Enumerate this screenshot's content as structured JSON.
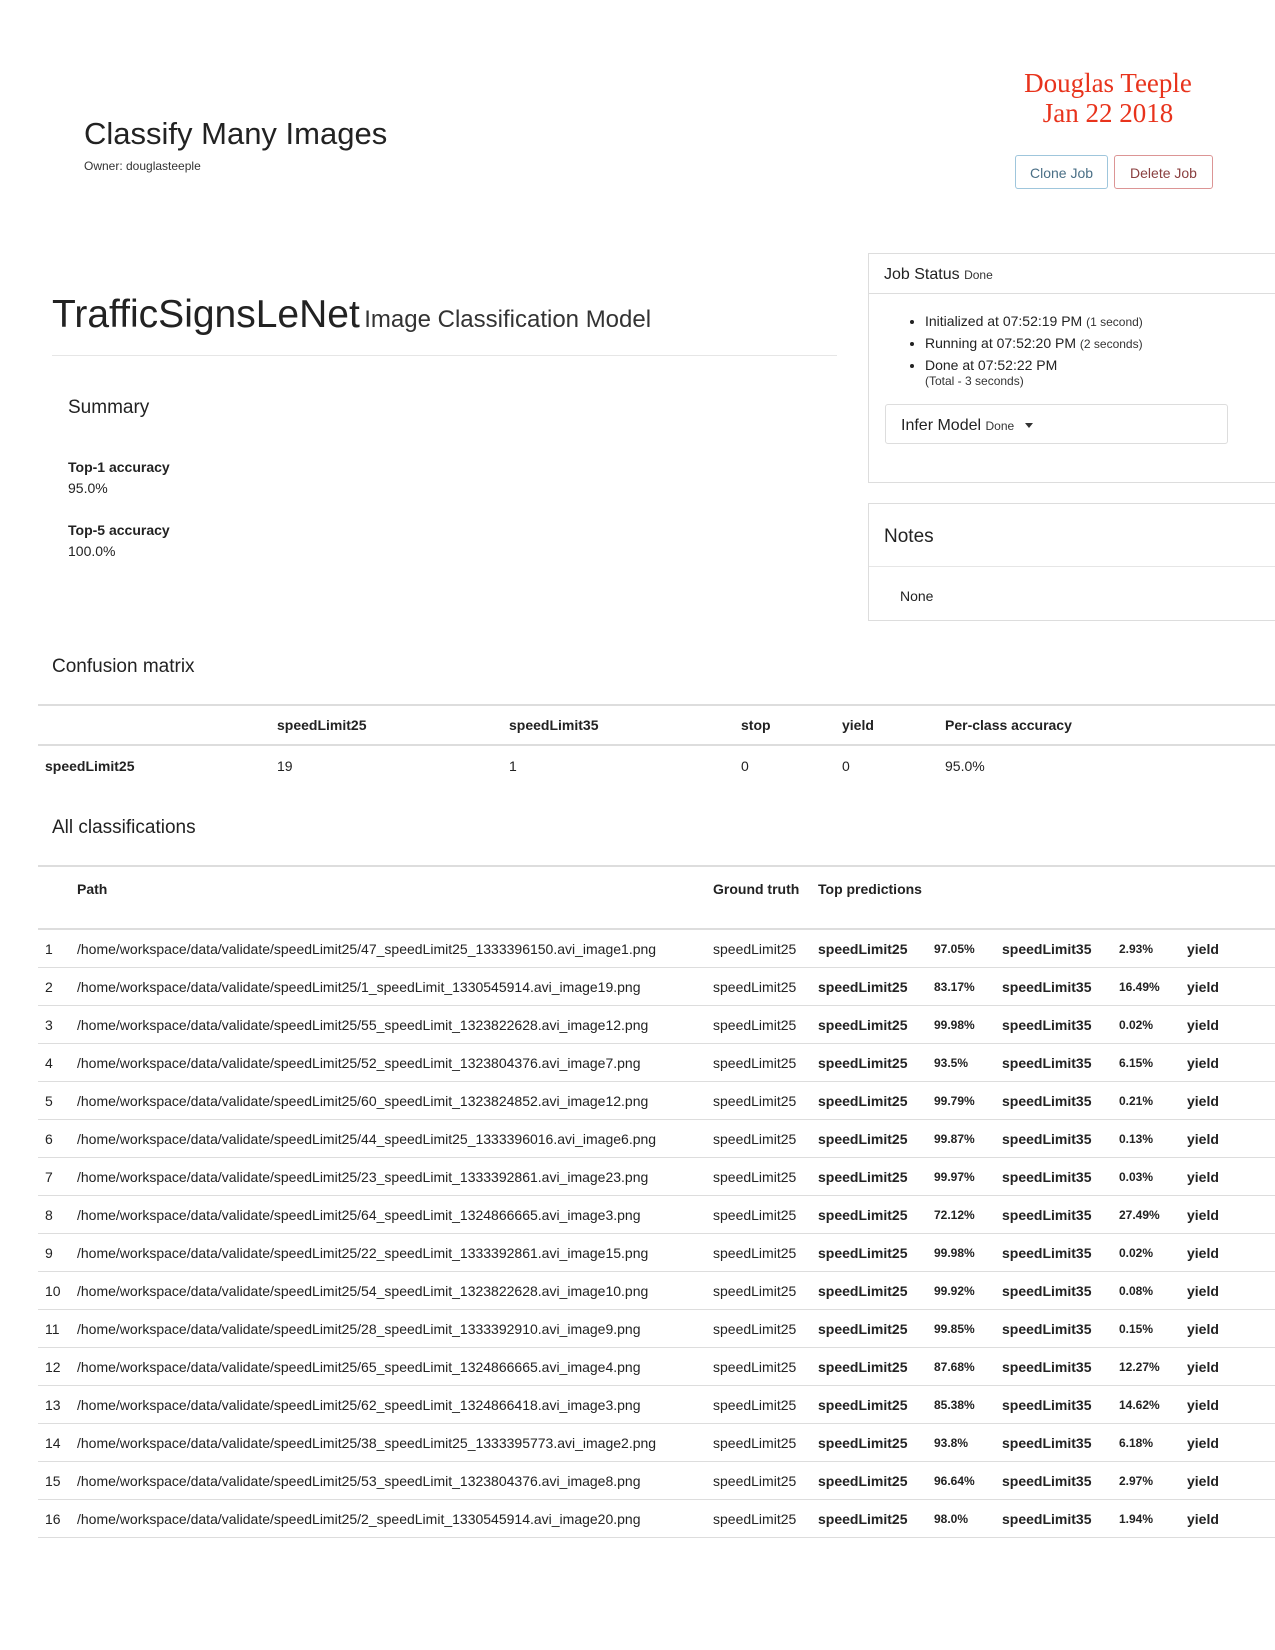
{
  "annotation": {
    "name": "Douglas Teeple",
    "date": "Jan 22 2018"
  },
  "header": {
    "title": "Classify Many Images",
    "owner": "Owner: douglasteeple",
    "clone_label": "Clone Job",
    "delete_label": "Delete Job"
  },
  "model": {
    "name": "TrafficSignsLeNet",
    "type": "Image Classification Model"
  },
  "summary": {
    "title": "Summary",
    "top1_label": "Top-1 accuracy",
    "top1_value": "95.0%",
    "top5_label": "Top-5 accuracy",
    "top5_value": "100.0%"
  },
  "job_status": {
    "label": "Job Status",
    "state": "Done",
    "events": [
      {
        "text": "Initialized at 07:52:19 PM",
        "duration": "(1 second)"
      },
      {
        "text": "Running at 07:52:20 PM",
        "duration": "(2 seconds)"
      },
      {
        "text": "Done at 07:52:22 PM",
        "duration": ""
      }
    ],
    "total": "(Total - 3 seconds)",
    "infer_label": "Infer Model",
    "infer_state": "Done"
  },
  "notes": {
    "title": "Notes",
    "body": "None"
  },
  "confusion": {
    "title": "Confusion matrix",
    "headers": [
      "",
      "speedLimit25",
      "speedLimit35",
      "stop",
      "yield",
      "Per-class accuracy"
    ],
    "row": [
      "speedLimit25",
      "19",
      "1",
      "0",
      "0",
      "95.0%"
    ]
  },
  "classifications": {
    "title": "All classifications",
    "headers": {
      "index": "",
      "path": "Path",
      "ground_truth": "Ground truth",
      "top": "Top predictions"
    },
    "rows": [
      [
        "1",
        "/home/workspace/data/validate/speedLimit25/47_speedLimit25_1333396150.avi_image1.png",
        "speedLimit25",
        "speedLimit25",
        "97.05%",
        "speedLimit35",
        "2.93%",
        "yield"
      ],
      [
        "2",
        "/home/workspace/data/validate/speedLimit25/1_speedLimit_1330545914.avi_image19.png",
        "speedLimit25",
        "speedLimit25",
        "83.17%",
        "speedLimit35",
        "16.49%",
        "yield"
      ],
      [
        "3",
        "/home/workspace/data/validate/speedLimit25/55_speedLimit_1323822628.avi_image12.png",
        "speedLimit25",
        "speedLimit25",
        "99.98%",
        "speedLimit35",
        "0.02%",
        "yield"
      ],
      [
        "4",
        "/home/workspace/data/validate/speedLimit25/52_speedLimit_1323804376.avi_image7.png",
        "speedLimit25",
        "speedLimit25",
        "93.5%",
        "speedLimit35",
        "6.15%",
        "yield"
      ],
      [
        "5",
        "/home/workspace/data/validate/speedLimit25/60_speedLimit_1323824852.avi_image12.png",
        "speedLimit25",
        "speedLimit25",
        "99.79%",
        "speedLimit35",
        "0.21%",
        "yield"
      ],
      [
        "6",
        "/home/workspace/data/validate/speedLimit25/44_speedLimit25_1333396016.avi_image6.png",
        "speedLimit25",
        "speedLimit25",
        "99.87%",
        "speedLimit35",
        "0.13%",
        "yield"
      ],
      [
        "7",
        "/home/workspace/data/validate/speedLimit25/23_speedLimit_1333392861.avi_image23.png",
        "speedLimit25",
        "speedLimit25",
        "99.97%",
        "speedLimit35",
        "0.03%",
        "yield"
      ],
      [
        "8",
        "/home/workspace/data/validate/speedLimit25/64_speedLimit_1324866665.avi_image3.png",
        "speedLimit25",
        "speedLimit25",
        "72.12%",
        "speedLimit35",
        "27.49%",
        "yield"
      ],
      [
        "9",
        "/home/workspace/data/validate/speedLimit25/22_speedLimit_1333392861.avi_image15.png",
        "speedLimit25",
        "speedLimit25",
        "99.98%",
        "speedLimit35",
        "0.02%",
        "yield"
      ],
      [
        "10",
        "/home/workspace/data/validate/speedLimit25/54_speedLimit_1323822628.avi_image10.png",
        "speedLimit25",
        "speedLimit25",
        "99.92%",
        "speedLimit35",
        "0.08%",
        "yield"
      ],
      [
        "11",
        "/home/workspace/data/validate/speedLimit25/28_speedLimit_1333392910.avi_image9.png",
        "speedLimit25",
        "speedLimit25",
        "99.85%",
        "speedLimit35",
        "0.15%",
        "yield"
      ],
      [
        "12",
        "/home/workspace/data/validate/speedLimit25/65_speedLimit_1324866665.avi_image4.png",
        "speedLimit25",
        "speedLimit25",
        "87.68%",
        "speedLimit35",
        "12.27%",
        "yield"
      ],
      [
        "13",
        "/home/workspace/data/validate/speedLimit25/62_speedLimit_1324866418.avi_image3.png",
        "speedLimit25",
        "speedLimit25",
        "85.38%",
        "speedLimit35",
        "14.62%",
        "yield"
      ],
      [
        "14",
        "/home/workspace/data/validate/speedLimit25/38_speedLimit25_1333395773.avi_image2.png",
        "speedLimit25",
        "speedLimit25",
        "93.8%",
        "speedLimit35",
        "6.18%",
        "yield"
      ],
      [
        "15",
        "/home/workspace/data/validate/speedLimit25/53_speedLimit_1323804376.avi_image8.png",
        "speedLimit25",
        "speedLimit25",
        "96.64%",
        "speedLimit35",
        "2.97%",
        "yield"
      ],
      [
        "16",
        "/home/workspace/data/validate/speedLimit25/2_speedLimit_1330545914.avi_image20.png",
        "speedLimit25",
        "speedLimit25",
        "98.0%",
        "speedLimit35",
        "1.94%",
        "yield"
      ]
    ]
  }
}
